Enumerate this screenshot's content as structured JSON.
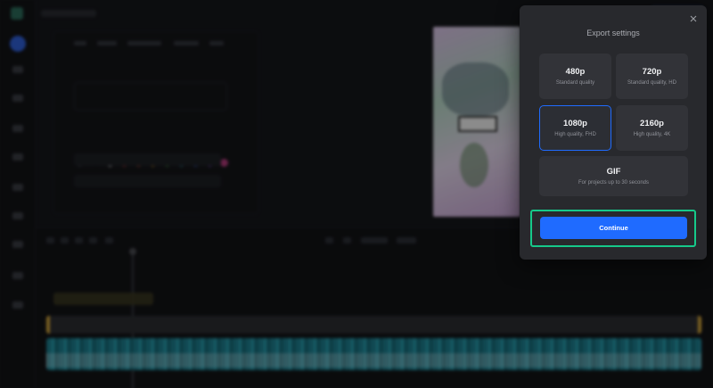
{
  "modal": {
    "title": "Export settings",
    "close_icon": "close-icon",
    "options": [
      {
        "label": "480p",
        "desc": "Standard quality"
      },
      {
        "label": "720p",
        "desc": "Standard quality, HD"
      },
      {
        "label": "1080p",
        "desc": "High quality, FHD",
        "selected": true
      },
      {
        "label": "2160p",
        "desc": "High quality, 4K"
      },
      {
        "label": "GIF",
        "desc": "For projects up to 30 seconds"
      }
    ],
    "continue_label": "Continue"
  },
  "colors": {
    "accent": "#1f6bff",
    "highlight": "#16c98a",
    "modal_bg": "#28292d",
    "option_bg": "#323338"
  }
}
